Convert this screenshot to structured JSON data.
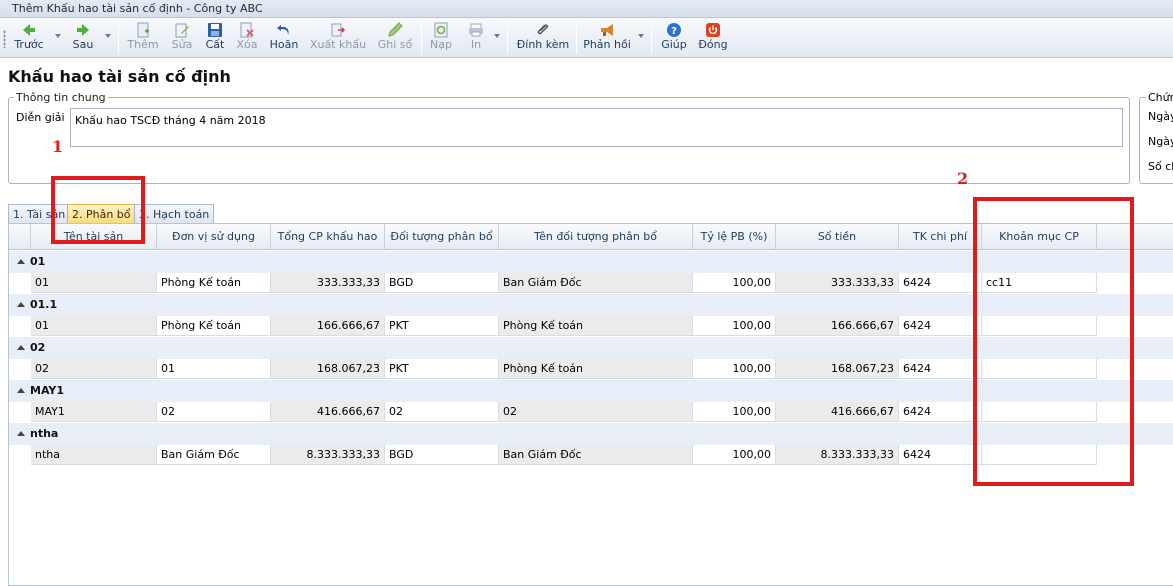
{
  "window": {
    "title": "Thêm Khấu hao tài sản cố định - Công ty ABC"
  },
  "toolbar": {
    "prev": "Trước",
    "next": "Sau",
    "add": "Thêm",
    "edit": "Sửa",
    "save": "Cất",
    "delete": "Xóa",
    "undo": "Hoãn",
    "export": "Xuất khẩu",
    "post": "Ghi sổ",
    "load": "Nạp",
    "print": "In",
    "attach": "Đính kèm",
    "feedback": "Phản hồi",
    "help": "Giúp",
    "close": "Đóng"
  },
  "page": {
    "title": "Khấu hao tài sản cố định"
  },
  "general_info": {
    "legend": "Thông tin chung",
    "description_label": "Diễn giải",
    "description_value": "Khấu hao TSCĐ tháng 4 năm 2018"
  },
  "voucher_info": {
    "legend": "Chứn",
    "date1_label": "Ngày",
    "date2_label": "Ngày",
    "number_label": "Số ch"
  },
  "tabs": [
    {
      "label": "1. Tài sản"
    },
    {
      "label": "2. Phân bổ"
    },
    {
      "label": "3. Hạch toán"
    }
  ],
  "grid": {
    "columns": [
      "Tên tài sản",
      "Đơn vị sử dụng",
      "Tổng CP khấu hao",
      "Đối tượng phân bổ",
      "Tên đối tượng phân bổ",
      "Tỷ lệ PB (%)",
      "Số tiền",
      "TK chi phí",
      "Khoản mục CP"
    ],
    "groups": [
      {
        "label": "01",
        "row": [
          "01",
          "Phòng Kế toán",
          "333.333,33",
          "BGD",
          "Ban Giám Đốc",
          "100,00",
          "333.333,33",
          "6424",
          "cc11"
        ]
      },
      {
        "label": "01.1",
        "row": [
          "01",
          "Phòng Kế toán",
          "166.666,67",
          "PKT",
          "Phòng Kế toán",
          "100,00",
          "166.666,67",
          "6424",
          ""
        ]
      },
      {
        "label": "02",
        "row": [
          "02",
          "01",
          "168.067,23",
          "PKT",
          "Phòng Kế toán",
          "100,00",
          "168.067,23",
          "6424",
          ""
        ]
      },
      {
        "label": "MAY1",
        "row": [
          "MAY1",
          "02",
          "416.666,67",
          "02",
          "02",
          "100,00",
          "416.666,67",
          "6424",
          ""
        ]
      },
      {
        "label": "ntha",
        "row": [
          "ntha",
          "Ban Giám Đốc",
          "8.333.333,33",
          "BGD",
          "Ban Giám Đốc",
          "100,00",
          "8.333.333,33",
          "6424",
          ""
        ]
      }
    ]
  },
  "annotations": {
    "marker1": "1",
    "marker2": "2",
    "color": "#e01b1b"
  }
}
